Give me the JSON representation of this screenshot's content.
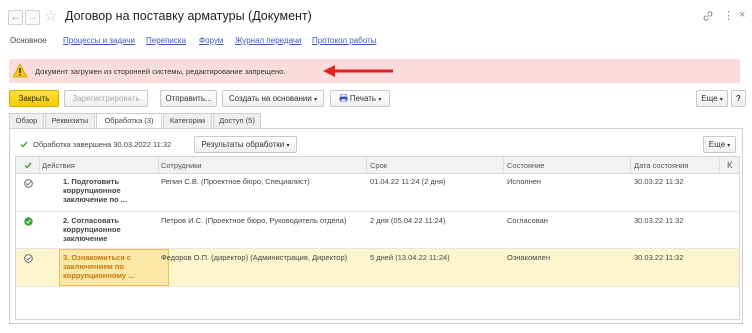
{
  "window": {
    "title": "Договор на поставку арматуры (Документ)",
    "back_glyph": "←",
    "forward_glyph": "→",
    "star_glyph": "☆",
    "link_glyph": "🔗",
    "more_glyph": "⋮",
    "close_glyph": "×"
  },
  "top_tabs": [
    {
      "label": "Основное",
      "active": true
    },
    {
      "label": "Процессы и задачи",
      "active": false
    },
    {
      "label": "Переписка",
      "active": false
    },
    {
      "label": "Форум",
      "active": false
    },
    {
      "label": "Журнал передачи",
      "active": false
    },
    {
      "label": "Протокол работы",
      "active": false
    }
  ],
  "warning": {
    "text": "Документ загружен из сторонней системы, редактирование запрещено.",
    "colors": {
      "background": "#fbdcdc",
      "arrow": "#e52020",
      "icon": "#f3c316"
    }
  },
  "toolbar": {
    "close_label": "Закрыть",
    "register_label": "Зарегистрировать",
    "send_label": "Отправить...",
    "create_based_label": "Создать на основании",
    "print_label": "Печать",
    "more_label": "Еще",
    "help_label": "?"
  },
  "inner_tabs": [
    {
      "label": "Обзор",
      "active": false
    },
    {
      "label": "Реквизиты",
      "active": false
    },
    {
      "label": "Обработка (3)",
      "active": true
    },
    {
      "label": "Категории",
      "active": false
    },
    {
      "label": "Доступ (5)",
      "active": false
    }
  ],
  "processing": {
    "status_text": "Обработка завершена  30.03.2022 11:32",
    "results_label": "Результаты обработки",
    "more_label": "Еще"
  },
  "table": {
    "headers": [
      "Действия",
      "Сотрудники",
      "Срок",
      "Состояние",
      "Дата состояния",
      "К"
    ],
    "rows": [
      {
        "icon": "pending-check-icon",
        "action": "1. Подготовить коррупционное заключение по ...",
        "employees": "Репин С.В. (Проектное бюро, Специалист)",
        "deadline": "01.04.22 11:24 (2 дня)",
        "state": "Исполнен",
        "state_date": "30.03.22 11:32",
        "selected": false
      },
      {
        "icon": "done-check-icon",
        "action": "2. Согласовать коррупционное заключение",
        "employees": "Петров И.С. (Проектное бюро, Руководитель отдела)",
        "deadline": "2 дня (05.04.22 11:24)",
        "state": "Согласован",
        "state_date": "30.03.22 11:32",
        "selected": false
      },
      {
        "icon": "pending-check-icon",
        "action": "3. Ознакомиться с заключением по коррупционному ...",
        "employees": "Федоров О.П. (директор) (Администрация, Директор)",
        "deadline": "5 дней (13.04.22 11:24)",
        "state": "Ознакомлен",
        "state_date": "30.03.22 11:32",
        "selected": true
      }
    ]
  },
  "colors": {
    "primary_button": "#f5cc00",
    "link": "#3a5bb5",
    "selected_row": "#fdf5cd",
    "done_green": "#3aa43a"
  }
}
